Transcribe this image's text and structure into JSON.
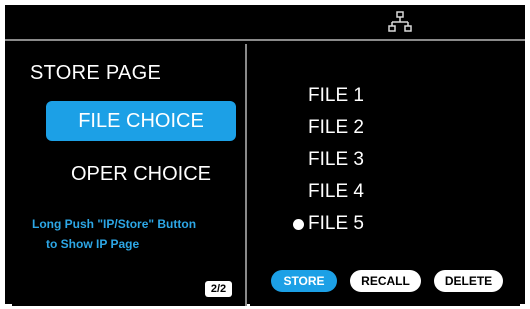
{
  "header": {
    "network_icon": "network-icon"
  },
  "left_panel": {
    "title": "STORE PAGE",
    "file_choice_label": "FILE CHOICE",
    "oper_choice_label": "OPER CHOICE",
    "hint_line1": "Long Push \"IP/Store\" Button",
    "hint_line2": "to Show IP Page",
    "page_indicator": "2/2"
  },
  "right_panel": {
    "files": [
      {
        "label": "FILE 1"
      },
      {
        "label": "FILE 2"
      },
      {
        "label": "FILE 3"
      },
      {
        "label": "FILE 4"
      },
      {
        "label": "FILE 5"
      }
    ],
    "actions": {
      "store_label": "STORE",
      "recall_label": "RECALL",
      "delete_label": "DELETE"
    }
  },
  "colors": {
    "accent": "#1ca0e6",
    "hint_text": "#2da7e6",
    "background": "#000000",
    "divider": "#8a8a8a"
  }
}
